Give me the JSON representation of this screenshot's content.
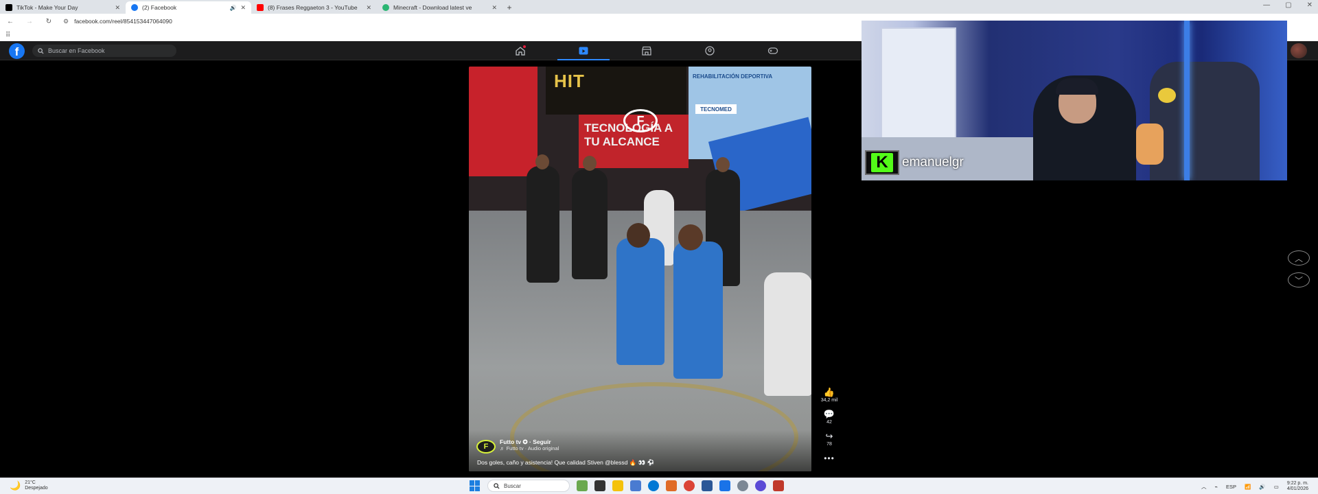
{
  "browser": {
    "tabs": [
      {
        "title": "TikTok - Make Your Day",
        "favicon_color": "#000000",
        "active": false,
        "has_audio": false
      },
      {
        "title": "(2) Facebook",
        "favicon_color": "#1877f2",
        "active": true,
        "has_audio": true
      },
      {
        "title": "(8) Frases Reggaeton 3 - YouTube",
        "favicon_color": "#ff0000",
        "active": false,
        "has_audio": false
      },
      {
        "title": "Minecraft - Download latest ve",
        "favicon_color": "#2bb673",
        "active": false,
        "has_audio": false
      }
    ],
    "close_glyph": "✕",
    "new_tab_glyph": "+",
    "url": "facebook.com/reel/854153447064090"
  },
  "facebook": {
    "search_placeholder": "Buscar en Facebook",
    "nav": [
      {
        "name": "home",
        "active": false,
        "badge": true
      },
      {
        "name": "reels",
        "active": true,
        "badge": false
      },
      {
        "name": "marketplace",
        "active": false,
        "badge": false
      },
      {
        "name": "groups",
        "active": false,
        "badge": false
      },
      {
        "name": "gaming",
        "active": false,
        "badge": false
      }
    ]
  },
  "reel": {
    "banner_hit": "HIT",
    "banner_tecno": "TECNOLOGÍA A TU ALCANCE",
    "banner_rehab": "REHABILITACIÓN DEPORTIVA",
    "banner_tecnomed": "TECNOMED",
    "author": "Futto tv ✪ · Seguir",
    "audio": "♬ Futto tv · Audio original",
    "caption": "Dos goles, caño y asistencia! Que calidad Stiven @blessd 🔥 👀 ⚽",
    "likes": "34,2 mil",
    "comments": "42",
    "shares": "78"
  },
  "stream_overlay": {
    "channel_name": "emanuelgr",
    "platform_letter": "K",
    "platform_color": "#53fc18"
  },
  "taskbar": {
    "temperature": "21°C",
    "weather": "Despejado",
    "search_placeholder": "Buscar",
    "language": "ESP",
    "time": "9:22 p. m.",
    "date": "4/01/2026",
    "app_colors": [
      "#6aa84f",
      "#333333",
      "#f4c20d",
      "#4a7bd1",
      "#0078d4",
      "#e06b27",
      "#db4437",
      "#2b5797",
      "#1a73e8",
      "#7b8794",
      "#5b4bd6",
      "#c0392b"
    ]
  }
}
